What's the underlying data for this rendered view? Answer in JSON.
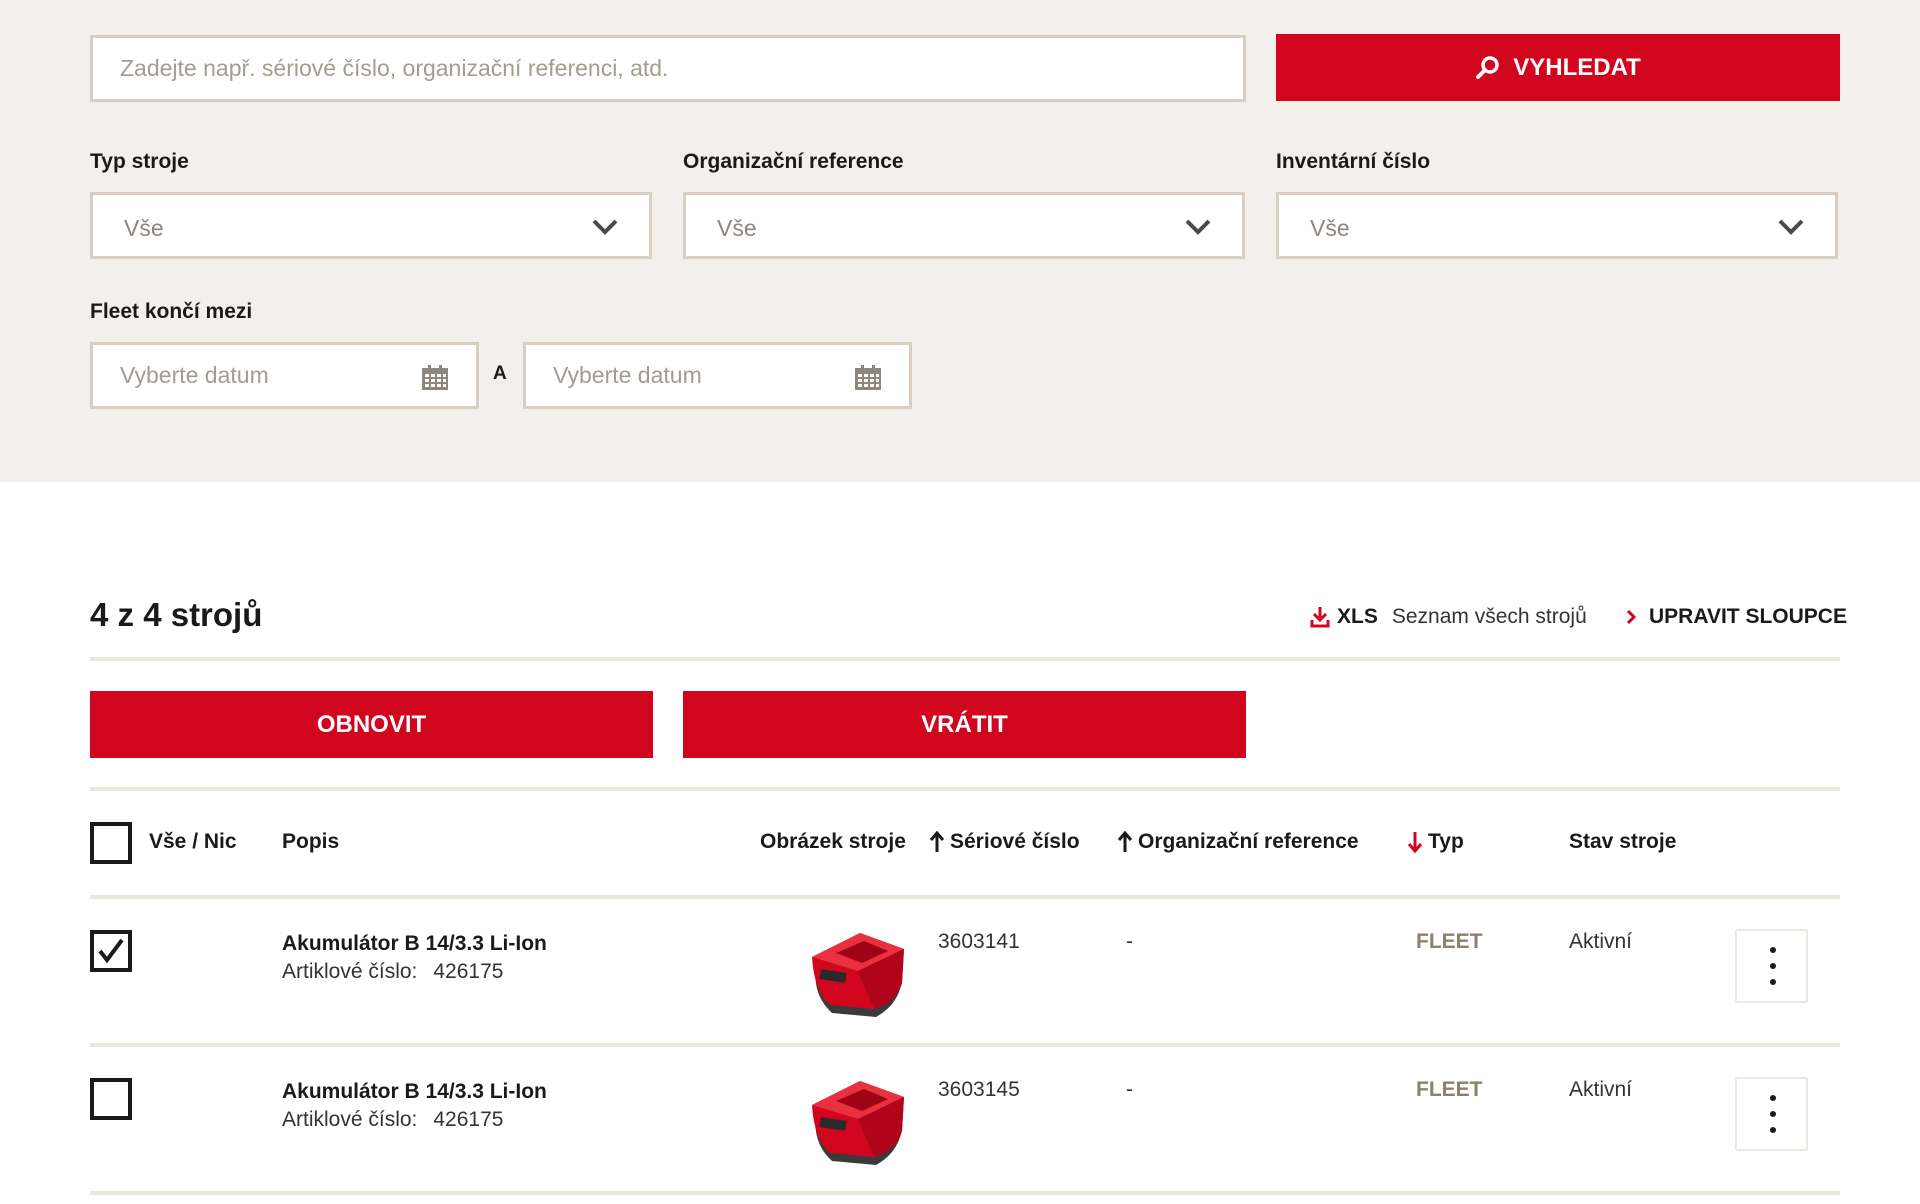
{
  "filters": {
    "search_placeholder": "Zadejte např. sériové číslo, organizační referenci, atd.",
    "search_button": "VYHLEDAT",
    "selects": [
      {
        "label": "Typ stroje",
        "value": "Vše"
      },
      {
        "label": "Organizační reference",
        "value": "Vše"
      },
      {
        "label": "Inventární číslo",
        "value": "Vše"
      }
    ],
    "date_range": {
      "label": "Fleet končí mezi",
      "from_placeholder": "Vyberte datum",
      "separator": "A",
      "to_placeholder": "Vyberte datum"
    }
  },
  "results": {
    "title": "4 z 4 strojů",
    "xls_label": "XLS",
    "xls_description": "Seznam všech strojů",
    "edit_columns": "UPRAVIT SLOUPCE",
    "actions": {
      "renew": "OBNOVIT",
      "return": "VRÁTIT"
    },
    "columns": {
      "select_all": "Vše / Nic",
      "description": "Popis",
      "image": "Obrázek stroje",
      "serial": "Sériové číslo",
      "org_ref": "Organizační reference",
      "type": "Typ",
      "status": "Stav stroje"
    },
    "rows": [
      {
        "checked": true,
        "name": "Akumulátor B 14/3.3 Li-Ion",
        "article_label": "Artiklové číslo:",
        "article_number": "426175",
        "serial": "3603141",
        "org_ref": "-",
        "type": "FLEET",
        "status": "Aktivní"
      },
      {
        "checked": false,
        "name": "Akumulátor B 14/3.3 Li-Ion",
        "article_label": "Artiklové číslo:",
        "article_number": "426175",
        "serial": "3603145",
        "org_ref": "-",
        "type": "FLEET",
        "status": "Aktivní"
      }
    ]
  },
  "colors": {
    "accent": "#d2051e",
    "panel": "#f3f0eb",
    "border": "#d8cfc0"
  },
  "icons": {
    "search": "search-icon",
    "chevron": "chevron-down-icon",
    "calendar": "calendar-icon",
    "download": "download-icon",
    "more": "more-vertical-icon"
  }
}
